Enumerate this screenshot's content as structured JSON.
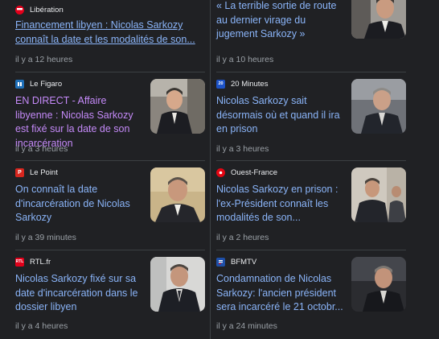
{
  "left": [
    {
      "source": "Libération",
      "logo": "liberation-logo-icon",
      "logo_color": "#e3001b",
      "title": "Financement libyen : Nicolas Sarkozy connaît la date et les modalités de son...",
      "time": "il y a 12 heures"
    },
    {
      "source": "Le Figaro",
      "logo": "le-figaro-logo-icon",
      "logo_color": "#1e6fb8",
      "title": "EN DIRECT - Affaire libyenne : Nicolas Sarkozy est fixé sur la date de son incarcération",
      "time": "il y a 3 heures"
    },
    {
      "source": "Le Point",
      "logo": "le-point-logo-icon",
      "logo_color": "#d7261e",
      "title": "On connaît la date d'incarcération de Nicolas Sarkozy",
      "time": "il y a 39 minutes"
    },
    {
      "source": "RTL.fr",
      "logo": "rtl-logo-icon",
      "logo_color": "#e2001a",
      "title": "Nicolas Sarkozy fixé sur sa date d'incarcération dans le dossier libyen",
      "time": "il y a 4 heures"
    }
  ],
  "right": [
    {
      "title": "« La terrible sortie de route au dernier virage du jugement Sarkozy »",
      "time": "il y a 10 heures"
    },
    {
      "source": "20 Minutes",
      "logo": "20-minutes-logo-icon",
      "logo_color": "#1c52c6",
      "title": "Nicolas Sarkozy sait désormais où et quand il ira en prison",
      "time": "il y a 3 heures"
    },
    {
      "source": "Ouest-France",
      "logo": "ouest-france-logo-icon",
      "logo_color": "#e30613",
      "title": "Nicolas Sarkozy en prison : l'ex-Président connaît les modalités de son...",
      "time": "il y a 2 heures"
    },
    {
      "source": "BFMTV",
      "logo": "bfmtv-logo-icon",
      "logo_color": "#1e4fa8",
      "title": "Condamnation de Nicolas Sarkozy: l'ancien président sera incarcéré le 21 octobr...",
      "time": "il y a 24 minutes"
    }
  ],
  "colors": {
    "background": "#202124",
    "link": "#8ab4f8",
    "visited_link": "#c58af9",
    "meta": "#9aa0a6",
    "divider": "#3c4043"
  }
}
